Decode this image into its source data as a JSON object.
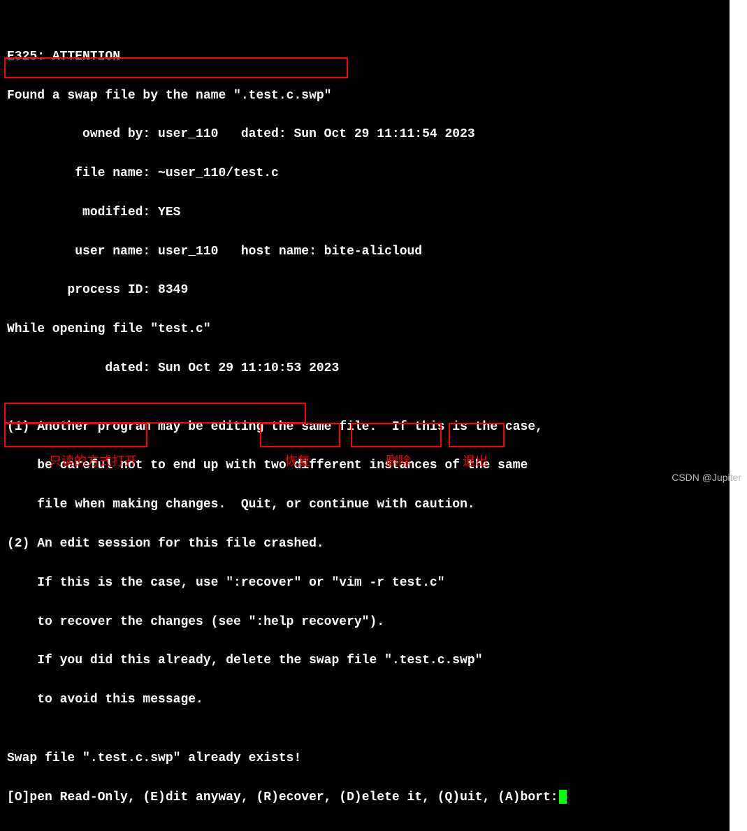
{
  "terminal": {
    "lines": [
      "",
      "E325: ATTENTION",
      "Found a swap file by the name \".test.c.swp\"",
      "          owned by: user_110   dated: Sun Oct 29 11:11:54 2023",
      "         file name: ~user_110/test.c",
      "          modified: YES",
      "         user name: user_110   host name: bite-alicloud",
      "        process ID: 8349",
      "While opening file \"test.c\"",
      "             dated: Sun Oct 29 11:10:53 2023",
      "",
      "(1) Another program may be editing the same file.  If this is the case,",
      "    be careful not to end up with two different instances of the same",
      "    file when making changes.  Quit, or continue with caution.",
      "(2) An edit session for this file crashed.",
      "    If this is the case, use \":recover\" or \"vim -r test.c\"",
      "    to recover the changes (see \":help recovery\").",
      "    If you did this already, delete the swap file \".test.c.swp\"",
      "    to avoid this message.",
      "",
      "Swap file \".test.c.swp\" already exists!"
    ],
    "prompt": {
      "open": "[O]pen Read-Only, ",
      "edit": "(E)dit anyway, ",
      "recover": "(R)ecover, ",
      "delete": "(D)elete it, ",
      "quit": "(Q)uit, ",
      "abort": "(A)bort:"
    }
  },
  "annotations": {
    "open_ro": "只读的方式打开",
    "recover": "恢复",
    "delete": "删除",
    "quit": "退出"
  },
  "watermark": "CSDN @Jupiter"
}
